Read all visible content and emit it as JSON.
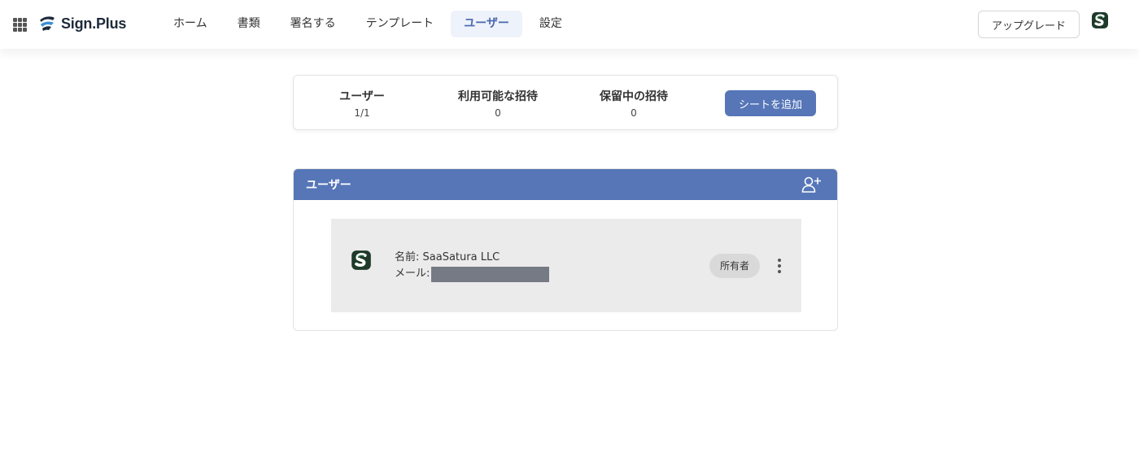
{
  "header": {
    "logo_text": "Sign.Plus",
    "nav": [
      {
        "label": "ホーム",
        "active": false
      },
      {
        "label": "書類",
        "active": false
      },
      {
        "label": "署名する",
        "active": false
      },
      {
        "label": "テンプレート",
        "active": false
      },
      {
        "label": "ユーザー",
        "active": true
      },
      {
        "label": "設定",
        "active": false
      }
    ],
    "upgrade_label": "アップグレード"
  },
  "stats": {
    "users_label": "ユーザー",
    "users_value": "1/1",
    "available_label": "利用可能な招待",
    "available_value": "0",
    "pending_label": "保留中の招待",
    "pending_value": "0",
    "add_seat_label": "シートを追加"
  },
  "users_panel": {
    "title": "ユーザー",
    "users": [
      {
        "name_label": "名前: SaaSatura LLC",
        "email_label": "メール:",
        "role": "所有者"
      }
    ]
  },
  "colors": {
    "accent": "#5676b8",
    "nav_active_bg": "#eef2fa",
    "row_bg": "#ebebeb",
    "badge_bg": "#d9d9d9",
    "logo_green": "#2d7a4f"
  },
  "icons": [
    "apps-grid-icon",
    "sign-plus-logo-icon",
    "user-avatar-icon",
    "add-user-icon",
    "more-vertical-icon"
  ]
}
